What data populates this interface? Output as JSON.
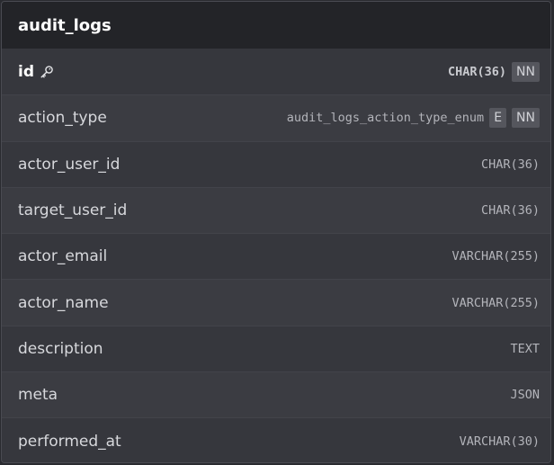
{
  "table": {
    "name": "audit_logs",
    "columns": [
      {
        "name": "id",
        "type": "CHAR(36)",
        "primary_key": true,
        "badges": [
          "NN"
        ]
      },
      {
        "name": "action_type",
        "type": "audit_logs_action_type_enum",
        "primary_key": false,
        "badges": [
          "E",
          "NN"
        ]
      },
      {
        "name": "actor_user_id",
        "type": "CHAR(36)",
        "primary_key": false,
        "badges": []
      },
      {
        "name": "target_user_id",
        "type": "CHAR(36)",
        "primary_key": false,
        "badges": []
      },
      {
        "name": "actor_email",
        "type": "VARCHAR(255)",
        "primary_key": false,
        "badges": []
      },
      {
        "name": "actor_name",
        "type": "VARCHAR(255)",
        "primary_key": false,
        "badges": []
      },
      {
        "name": "description",
        "type": "TEXT",
        "primary_key": false,
        "badges": []
      },
      {
        "name": "meta",
        "type": "JSON",
        "primary_key": false,
        "badges": []
      },
      {
        "name": "performed_at",
        "type": "VARCHAR(30)",
        "primary_key": false,
        "badges": []
      }
    ]
  },
  "icons": {
    "primary_key": "key-icon"
  }
}
